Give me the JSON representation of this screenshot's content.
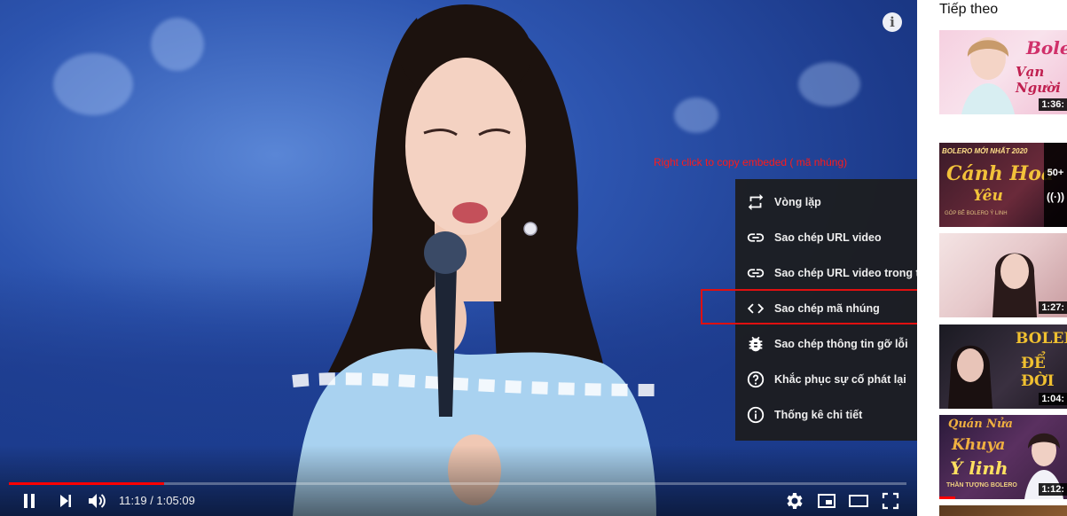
{
  "player": {
    "annotation": "Right click to copy embeded ( mã nhúng)",
    "info_icon": "i",
    "progress_fraction": 0.173,
    "time": {
      "current": "11:19",
      "separator": " / ",
      "total": "1:05:09"
    },
    "context_menu": [
      {
        "icon": "loop-icon",
        "label": "Vòng lặp"
      },
      {
        "icon": "link-icon",
        "label": "Sao chép URL video"
      },
      {
        "icon": "link-icon",
        "label": "Sao chép URL video trong thời gian hiện tại"
      },
      {
        "icon": "code-icon",
        "label": "Sao chép mã nhúng"
      },
      {
        "icon": "bug-icon",
        "label": "Sao chép thông tin gỡ lỗi"
      },
      {
        "icon": "help-icon",
        "label": "Khắc phục sự cố phát lại"
      },
      {
        "icon": "info-circle-icon",
        "label": "Thống kê chi tiết"
      }
    ],
    "colors": {
      "progress": "#ff0000",
      "highlight": "#e01010",
      "annotation": "#ff1a1a"
    }
  },
  "sidebar": {
    "title": "Tiếp theo",
    "videos": [
      {
        "overlay": [
          "Bolero",
          "Vạn Người"
        ],
        "duration": "1:36:"
      },
      {
        "overlay": [
          "BOLERO MỚI NHẤT 2020",
          "Cánh Hoa",
          "Yêu",
          "GÓP BÊ BOLERO Ý LINH"
        ],
        "live_count": "50+"
      },
      {
        "overlay": [],
        "duration": "1:27:"
      },
      {
        "overlay": [
          "BOLERO",
          "ĐỂ ĐỜI"
        ],
        "duration": "1:04:"
      },
      {
        "overlay": [
          "Quán Nửa",
          "Khuya",
          "Ý linh",
          "THẦN TƯỢNG BOLERO"
        ],
        "duration": "1:12:"
      }
    ]
  }
}
